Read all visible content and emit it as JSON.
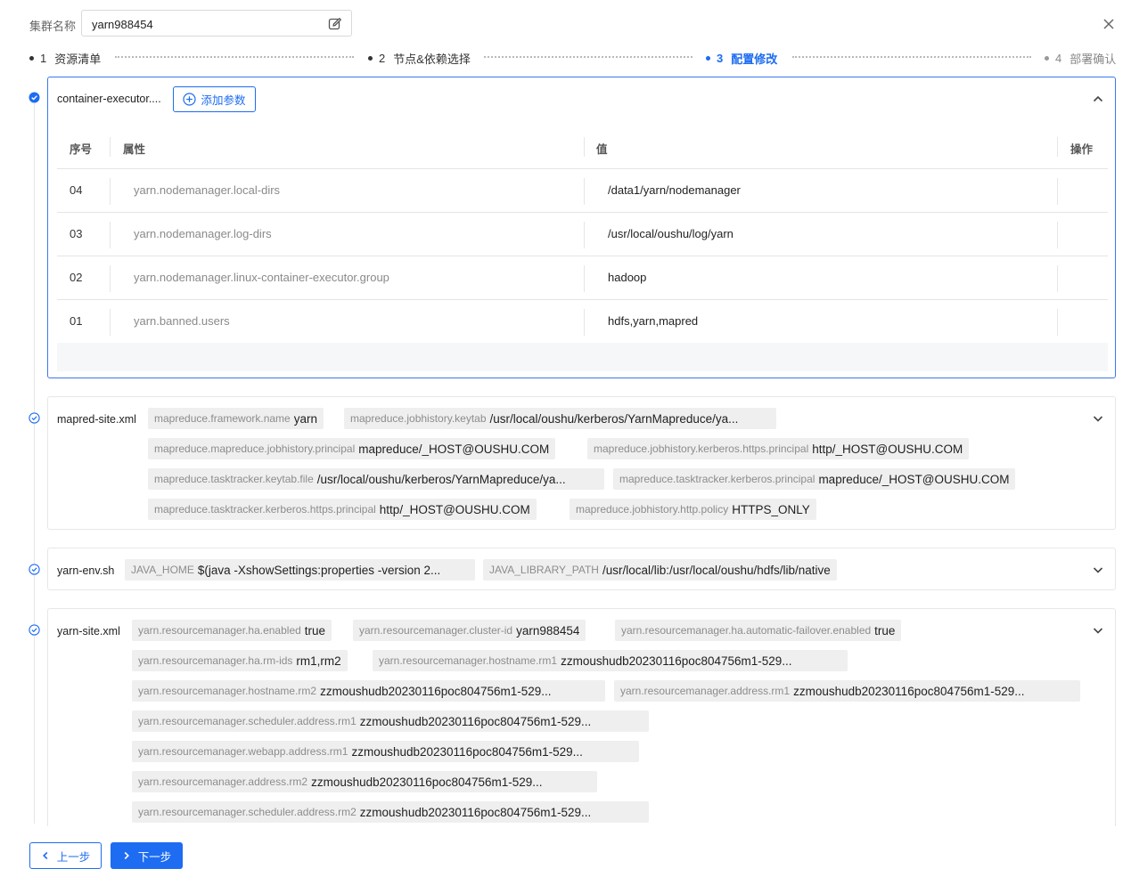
{
  "header": {
    "cluster_label": "集群名称",
    "cluster_name": "yarn988454"
  },
  "steps": [
    {
      "num": "1",
      "label": "资源清单"
    },
    {
      "num": "2",
      "label": "节点&依赖选择"
    },
    {
      "num": "3",
      "label": "配置修改"
    },
    {
      "num": "4",
      "label": "部署确认"
    }
  ],
  "container_card": {
    "title": "container-executor....",
    "add_label": "添加参数",
    "columns": {
      "no": "序号",
      "key": "属性",
      "value": "值",
      "action": "操作"
    },
    "rows": [
      {
        "no": "04",
        "key": "yarn.nodemanager.local-dirs",
        "value": "/data1/yarn/nodemanager"
      },
      {
        "no": "03",
        "key": "yarn.nodemanager.log-dirs",
        "value": "/usr/local/oushu/log/yarn"
      },
      {
        "no": "02",
        "key": "yarn.nodemanager.linux-container-executor.group",
        "value": "hadoop"
      },
      {
        "no": "01",
        "key": "yarn.banned.users",
        "value": "hdfs,yarn,mapred"
      }
    ]
  },
  "mapred_card": {
    "title": "mapred-site.xml",
    "tags": [
      {
        "k": "mapreduce.framework.name",
        "v": "yarn"
      },
      {
        "k": "mapreduce.jobhistory.keytab",
        "v": "/usr/local/oushu/kerberos/YarnMapreduce/ya..."
      },
      {
        "k": "mapreduce.mapreduce.jobhistory.principal",
        "v": "mapreduce/_HOST@OUSHU.COM"
      },
      {
        "k": "mapreduce.jobhistory.kerberos.https.principal",
        "v": "http/_HOST@OUSHU.COM"
      },
      {
        "k": "mapreduce.tasktracker.keytab.file",
        "v": "/usr/local/oushu/kerberos/YarnMapreduce/ya..."
      },
      {
        "k": "mapreduce.tasktracker.kerberos.principal",
        "v": "mapreduce/_HOST@OUSHU.COM"
      },
      {
        "k": "mapreduce.tasktracker.kerberos.https.principal",
        "v": "http/_HOST@OUSHU.COM"
      },
      {
        "k": "mapreduce.jobhistory.http.policy",
        "v": "HTTPS_ONLY"
      }
    ]
  },
  "env_card": {
    "title": "yarn-env.sh",
    "tags": [
      {
        "k": "JAVA_HOME",
        "v": "$(java -XshowSettings:properties -version 2..."
      },
      {
        "k": "JAVA_LIBRARY_PATH",
        "v": "/usr/local/lib:/usr/local/oushu/hdfs/lib/native"
      }
    ]
  },
  "site_card": {
    "title": "yarn-site.xml",
    "tags": [
      {
        "k": "yarn.resourcemanager.ha.enabled",
        "v": "true"
      },
      {
        "k": "yarn.resourcemanager.cluster-id",
        "v": "yarn988454"
      },
      {
        "k": "yarn.resourcemanager.ha.automatic-failover.enabled",
        "v": "true"
      },
      {
        "k": "yarn.resourcemanager.ha.rm-ids",
        "v": "rm1,rm2"
      },
      {
        "k": "yarn.resourcemanager.hostname.rm1",
        "v": "zzmoushudb20230116poc804756m1-529..."
      },
      {
        "k": "yarn.resourcemanager.hostname.rm2",
        "v": "zzmoushudb20230116poc804756m1-529..."
      },
      {
        "k": "yarn.resourcemanager.address.rm1",
        "v": "zzmoushudb20230116poc804756m1-529..."
      },
      {
        "k": "yarn.resourcemanager.scheduler.address.rm1",
        "v": "zzmoushudb20230116poc804756m1-529..."
      },
      {
        "k": "yarn.resourcemanager.webapp.address.rm1",
        "v": "zzmoushudb20230116poc804756m1-529..."
      },
      {
        "k": "yarn.resourcemanager.address.rm2",
        "v": "zzmoushudb20230116poc804756m1-529..."
      },
      {
        "k": "yarn.resourcemanager.scheduler.address.rm2",
        "v": "zzmoushudb20230116poc804756m1-529..."
      }
    ]
  },
  "footer": {
    "prev_label": "上一步",
    "next_label": "下一步"
  },
  "colors": {
    "accent": "#1d6cf2",
    "tag_bg": "#efefef"
  }
}
